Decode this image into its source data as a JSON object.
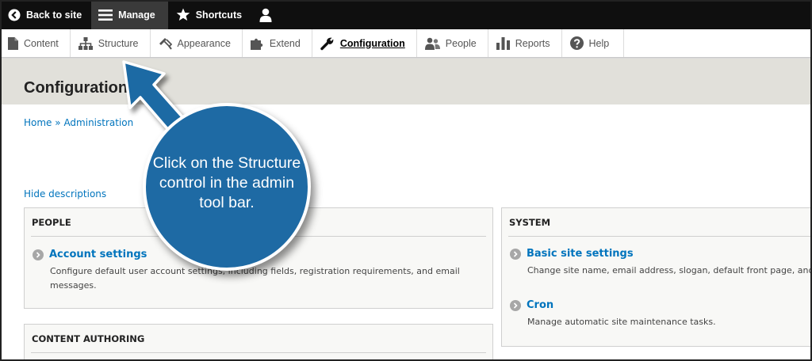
{
  "topbar": {
    "back_label": "Back to site",
    "manage_label": "Manage",
    "shortcuts_label": "Shortcuts"
  },
  "tray": {
    "items": [
      {
        "label": "Content",
        "icon": "file-icon"
      },
      {
        "label": "Structure",
        "icon": "hierarchy-icon"
      },
      {
        "label": "Appearance",
        "icon": "paintbrush-icon"
      },
      {
        "label": "Extend",
        "icon": "puzzle-icon"
      },
      {
        "label": "Configuration",
        "icon": "wrench-icon"
      },
      {
        "label": "People",
        "icon": "people-icon"
      },
      {
        "label": "Reports",
        "icon": "bar-chart-icon"
      },
      {
        "label": "Help",
        "icon": "help-icon"
      }
    ],
    "active": "Configuration"
  },
  "page": {
    "title": "Configuration",
    "breadcrumb_home": "Home",
    "breadcrumb_sep": "»",
    "breadcrumb_admin": "Administration",
    "hide_descriptions": "Hide descriptions"
  },
  "panels": {
    "people": {
      "heading": "PEOPLE",
      "entry_title": "Account settings",
      "entry_desc": "Configure default user account settings, including fields, registration requirements, and email messages."
    },
    "content_authoring": {
      "heading": "CONTENT AUTHORING"
    },
    "system": {
      "heading": "SYSTEM",
      "entries": [
        {
          "title": "Basic site settings",
          "desc": "Change site name, email address, slogan, default front page, and"
        },
        {
          "title": "Cron",
          "desc": "Manage automatic site maintenance tasks."
        }
      ]
    }
  },
  "callout": {
    "text": "Click on the Structure control in the admin tool bar."
  },
  "colors": {
    "link": "#0074bd",
    "callout": "#1e6aa4",
    "header_band": "#e1e0da",
    "topbar": "#0f0f0f"
  }
}
